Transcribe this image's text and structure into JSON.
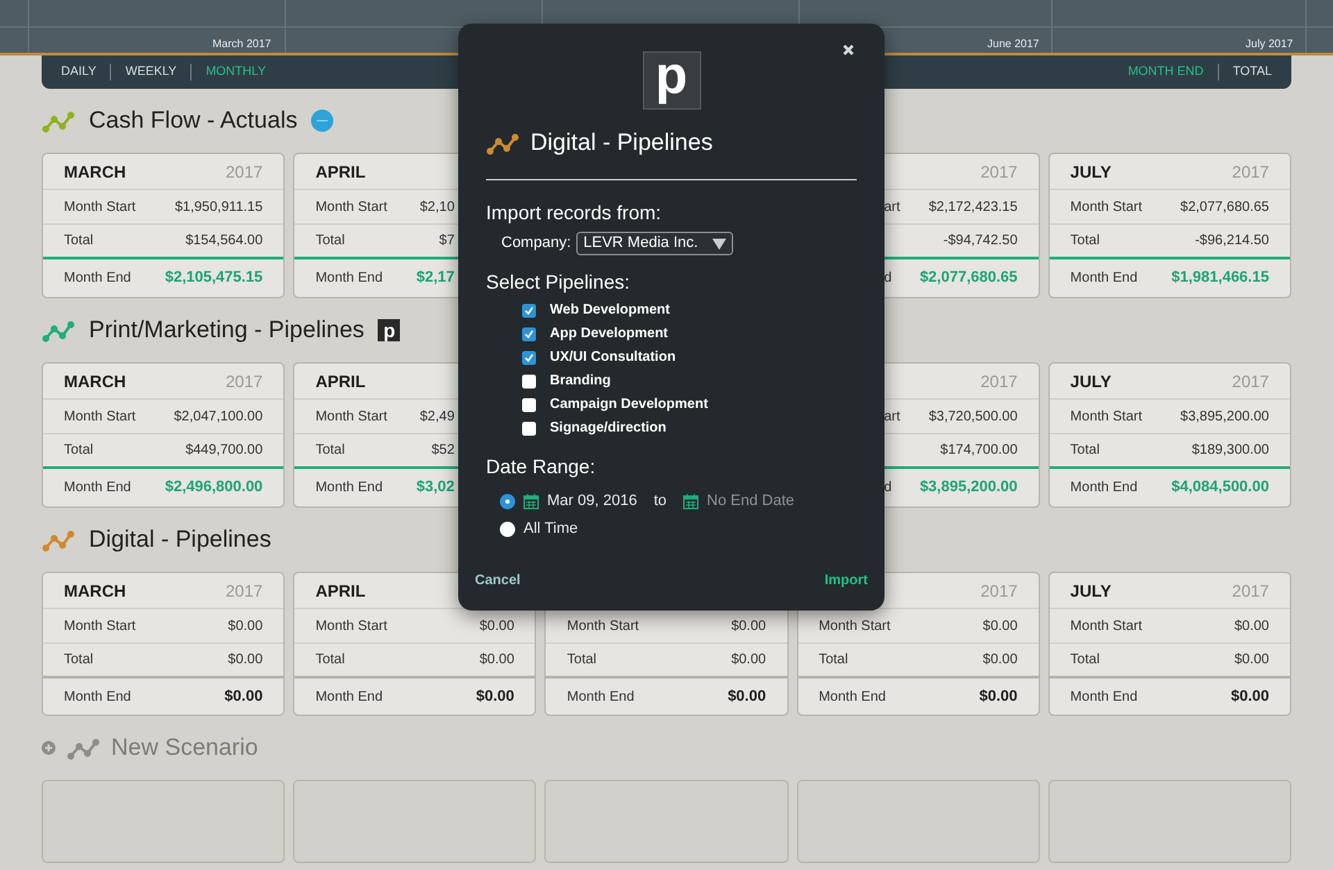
{
  "timeline": {
    "labels": [
      "March 2017",
      "June 2017",
      "July 2017"
    ]
  },
  "tabs_left": [
    {
      "label": "DAILY",
      "selected": false
    },
    {
      "label": "WEEKLY",
      "selected": false
    },
    {
      "label": "MONTHLY",
      "selected": true
    }
  ],
  "tabs_right": [
    {
      "label": "MONTH END",
      "selected": true
    },
    {
      "label": "TOTAL",
      "selected": false
    }
  ],
  "sections": [
    {
      "kind": "scenario",
      "title": "Cash Flow - Actuals",
      "color": "#8db31e",
      "badge": {
        "kind": "circle"
      },
      "highlight_end": true,
      "cards": [
        {
          "month": "MARCH",
          "year": "2017",
          "start_label": "Month Start",
          "start": "$1,950,911.15",
          "total_label": "Total",
          "total": "$154,564.00",
          "end_label": "Month End",
          "end": "$2,105,475.15"
        },
        {
          "month": "APRIL",
          "start_label": "Month Start",
          "start": "$2,10",
          "total_label": "Total",
          "total": "$7",
          "end_label": "Month End",
          "end": "$2,17"
        },
        {
          "year": "2017",
          "start_label": "art",
          "start": "$2,172,423.15",
          "total": "-$94,742.50",
          "end_label": "d",
          "end": "$2,077,680.65"
        },
        {
          "month": "JULY",
          "year": "2017",
          "start_label": "Month Start",
          "start": "$2,077,680.65",
          "total_label": "Total",
          "total": "-$96,214.50",
          "end_label": "Month End",
          "end": "$1,981,466.15"
        }
      ]
    },
    {
      "kind": "scenario",
      "title": "Print/Marketing - Pipelines",
      "color": "#1fae7c",
      "badge": {
        "kind": "letter",
        "text": "p"
      },
      "highlight_end": true,
      "cards": [
        {
          "month": "MARCH",
          "year": "2017",
          "start_label": "Month Start",
          "start": "$2,047,100.00",
          "total_label": "Total",
          "total": "$449,700.00",
          "end_label": "Month End",
          "end": "$2,496,800.00"
        },
        {
          "month": "APRIL",
          "start_label": "Month Start",
          "start": "$2,49",
          "total_label": "Total",
          "total": "$52",
          "end_label": "Month End",
          "end": "$3,02"
        },
        {
          "year": "2017",
          "start_label": "art",
          "start": "$3,720,500.00",
          "total": "$174,700.00",
          "end_label": "d",
          "end": "$3,895,200.00"
        },
        {
          "month": "JULY",
          "year": "2017",
          "start_label": "Month Start",
          "start": "$3,895,200.00",
          "total_label": "Total",
          "total": "$189,300.00",
          "end_label": "Month End",
          "end": "$4,084,500.00"
        }
      ]
    },
    {
      "kind": "scenario",
      "title": "Digital - Pipelines",
      "color": "#d08a2e",
      "highlight_end": false,
      "cards": [
        {
          "month": "MARCH",
          "year": "2017",
          "start_label": "Month Start",
          "start": "$0.00",
          "total_label": "Total",
          "total": "$0.00",
          "end_label": "Month End",
          "end": "$0.00"
        },
        {
          "month": "APRIL",
          "start_label": "Month Start",
          "start": "$0.00",
          "total_label": "Total",
          "total": "$0.00",
          "end_label": "Month End",
          "end": "$0.00"
        },
        {
          "start_label": "Month Start",
          "start": "$0.00",
          "total_label": "Total",
          "total": "$0.00",
          "end_label": "Month End",
          "end": "$0.00"
        },
        {
          "year": "2017",
          "start_label": "Month Start",
          "start": "$0.00",
          "total_label": "Total",
          "total": "$0.00",
          "end_label": "Month End",
          "end": "$0.00"
        },
        {
          "month": "JULY",
          "year": "2017",
          "start_label": "Month Start",
          "start": "$0.00",
          "total_label": "Total",
          "total": "$0.00",
          "end_label": "Month End",
          "end": "$0.00"
        }
      ]
    },
    {
      "kind": "new",
      "title": "New Scenario"
    }
  ],
  "modal": {
    "logo": "p",
    "title": "Digital - Pipelines",
    "import_heading": "Import records from:",
    "company_label": "Company:",
    "company": "LEVR Media Inc.",
    "pipelines_heading": "Select Pipelines:",
    "pipelines": [
      {
        "label": "Web Development",
        "checked": true
      },
      {
        "label": "App Development",
        "checked": true
      },
      {
        "label": "UX/UI Consultation",
        "checked": true
      },
      {
        "label": "Branding",
        "checked": false
      },
      {
        "label": "Campaign Development",
        "checked": false
      },
      {
        "label": "Signage/direction",
        "checked": false
      }
    ],
    "date_heading": "Date Range:",
    "ranges": [
      {
        "kind": "dates",
        "selected": true,
        "start": "Mar 09, 2016",
        "separator": "to",
        "end_placeholder": "No End Date"
      },
      {
        "kind": "all",
        "selected": false,
        "label": "All Time"
      }
    ],
    "cancel": "Cancel",
    "import": "Import"
  }
}
